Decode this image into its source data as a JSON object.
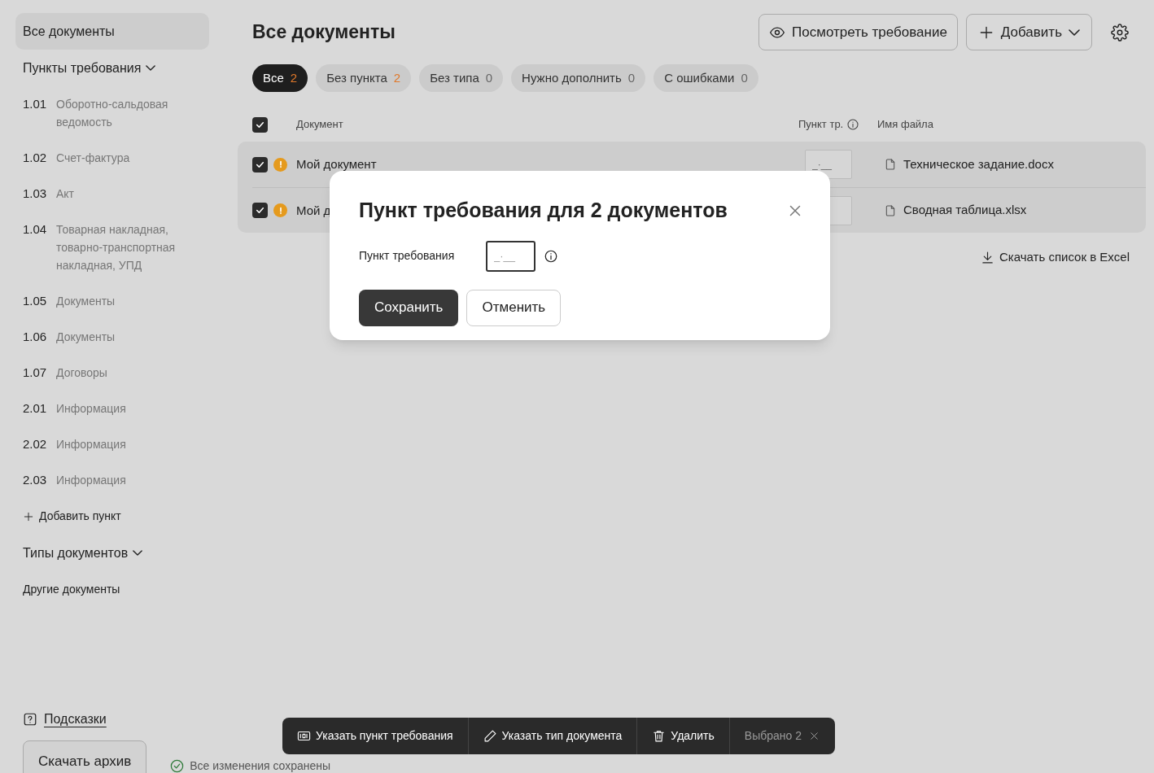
{
  "sidebar": {
    "all_documents": {
      "label": "Все документы",
      "selected": true
    },
    "sections": [
      {
        "kind": "numbered",
        "title": "Пункты требования",
        "expanded": true,
        "items": [
          {
            "num": "1.01",
            "label": "Оборотно-сальдовая ведомость"
          },
          {
            "num": "1.02",
            "label": "Счет-фактура"
          },
          {
            "num": "1.03",
            "label": "Акт"
          },
          {
            "num": "1.04",
            "label": "Товарная накладная, товарно-транспортная накладная, УПД"
          },
          {
            "num": "1.05",
            "label": "Документы"
          },
          {
            "num": "1.06",
            "label": "Документы"
          },
          {
            "num": "1.07",
            "label": "Договоры"
          },
          {
            "num": "2.01",
            "label": "Информация"
          },
          {
            "num": "2.02",
            "label": "Информация"
          },
          {
            "num": "2.03",
            "label": "Информация"
          }
        ],
        "add_label": "Добавить пункт"
      },
      {
        "kind": "plain",
        "title": "Типы документов",
        "expanded": true,
        "items": [
          {
            "label": "Другие документы"
          }
        ]
      }
    ],
    "hints_link": "Подсказки",
    "download_archive": "Скачать архив",
    "save_status": "Все изменения сохранены"
  },
  "header": {
    "title": "Все документы",
    "view_button": "Посмотреть требование",
    "add_button": "Добавить"
  },
  "tabs": [
    {
      "label": "Все",
      "count": "2",
      "alert": true,
      "selected": true
    },
    {
      "label": "Без пункта",
      "count": "2",
      "alert": true,
      "selected": false
    },
    {
      "label": "Без типа",
      "count": "0",
      "alert": false,
      "selected": false
    },
    {
      "label": "Нужно дополнить",
      "count": "0",
      "alert": false,
      "selected": false
    },
    {
      "label": "С ошибками",
      "count": "0",
      "alert": false,
      "selected": false
    }
  ],
  "table": {
    "all_checked": true,
    "columns": [
      "Документ",
      "Пункт тр.",
      "Имя файла"
    ],
    "rows": [
      {
        "checked": true,
        "warning": true,
        "name": "Мой документ",
        "point_placeholder": "_·__",
        "file": "Техническое задание.docx"
      },
      {
        "checked": true,
        "warning": true,
        "name": "Мой д",
        "file": "Сводная таблица.xlsx"
      }
    ]
  },
  "download_excel": "Скачать список в Excel",
  "action_bar": {
    "actions": [
      {
        "kind": "point",
        "label": "Указать пункт требования"
      },
      {
        "kind": "type",
        "label": "Указать тип документа"
      },
      {
        "kind": "delete",
        "label": "Удалить"
      }
    ],
    "selected_count": "Выбрано 2"
  },
  "modal": {
    "title": "Пункт требования для 2 документов",
    "field_label": "Пункт требования",
    "field_placeholder": "_·__",
    "save": "Сохранить",
    "cancel": "Отменить"
  }
}
